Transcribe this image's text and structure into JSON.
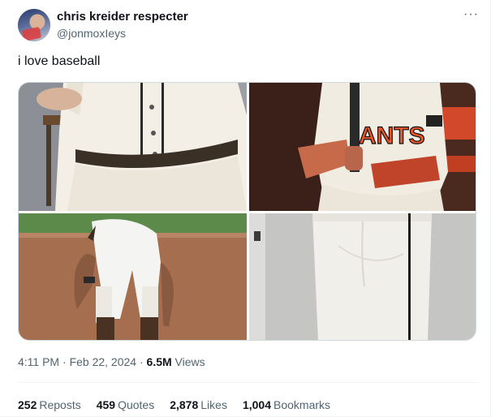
{
  "author": {
    "display_name": "chris kreider respecter",
    "handle": "@jonmoxIeys",
    "avatar_icon": "avatar-photo"
  },
  "more_icon": "···",
  "tweet_text": "i love baseball",
  "media": [
    {
      "name": "media-photo-1",
      "alt": "cream baseball uniform close-up"
    },
    {
      "name": "media-photo-2",
      "alt": "Giants player in cream uniform"
    },
    {
      "name": "media-photo-3",
      "alt": "player bent over on infield dirt"
    },
    {
      "name": "media-photo-4",
      "alt": "white baseball pants close-up"
    }
  ],
  "meta": {
    "time": "4:11 PM",
    "date": "Feb 22, 2024",
    "views_count": "6.5M",
    "views_label": "Views"
  },
  "stats": [
    {
      "count": "252",
      "label": "Reposts"
    },
    {
      "count": "459",
      "label": "Quotes"
    },
    {
      "count": "2,878",
      "label": "Likes"
    },
    {
      "count": "1,004",
      "label": "Bookmarks"
    }
  ],
  "colors": {
    "text": "#0f1419",
    "muted": "#536471",
    "border": "#cfd9de",
    "giants_orange": "#e8562a"
  }
}
